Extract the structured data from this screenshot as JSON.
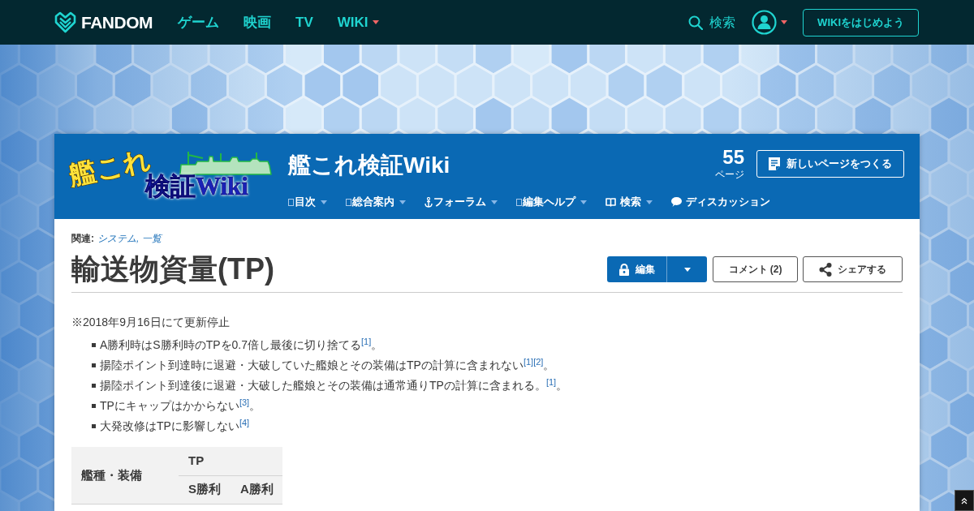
{
  "top_bar": {
    "brand": "FANDOM",
    "links": [
      {
        "label": "ゲーム",
        "has_menu": false
      },
      {
        "label": "映画",
        "has_menu": false
      },
      {
        "label": "TV",
        "has_menu": false
      },
      {
        "label": "WIKI",
        "has_menu": true
      }
    ],
    "search": {
      "label": "検索"
    },
    "start_wiki_button": "WIKIをはじめよう"
  },
  "wiki_header": {
    "logo": {
      "line_1": "艦これ",
      "line_2": "検証Wiki"
    },
    "title": "艦これ検証Wiki",
    "page_count": "55",
    "page_count_label": "ページ",
    "new_page_button": "新しいページをつくる",
    "nav": [
      {
        "label": "目次",
        "kind": "plain",
        "has_menu": true
      },
      {
        "label": "総合案内",
        "kind": "plain",
        "has_menu": true
      },
      {
        "label": "フォーラム",
        "kind": "anchor",
        "has_menu": true
      },
      {
        "label": "編集ヘルプ",
        "kind": "plain",
        "has_menu": true
      },
      {
        "label": "検索",
        "kind": "book",
        "has_menu": true
      },
      {
        "label": "ディスカッション",
        "kind": "chat",
        "has_menu": false
      }
    ]
  },
  "article": {
    "categories_label": "関連:",
    "categories": [
      "システム,",
      "一覧"
    ],
    "title": "輸送物資量(TP)",
    "actions": {
      "edit": "編集",
      "comments": "コメント (2)",
      "share": "シェアする"
    },
    "note": "※2018年9月16日にて更新停止",
    "bullets": [
      {
        "text": "A勝利時はS勝利時のTPを0.7倍し最後に切り捨てる",
        "refs": [
          "[1]"
        ],
        "tail": "。"
      },
      {
        "text": "揚陸ポイント到達時に退避・大破していた艦娘とその装備はTPの計算に含まれない",
        "refs": [
          "[1]",
          "[2]"
        ],
        "tail": "。"
      },
      {
        "text": "揚陸ポイント到達後に退避・大破した艦娘とその装備は通常通りTPの計算に含まれる。",
        "refs": [
          "[1]"
        ],
        "tail": "。"
      },
      {
        "text": "TPにキャップはかからない",
        "refs": [
          "[3]"
        ],
        "tail": "。"
      },
      {
        "text": "大発改修はTPに影響しない",
        "refs": [
          "[4]"
        ]
      }
    ],
    "table": {
      "row_header": "艦種・装備",
      "group": "TP",
      "columns": [
        "S勝利",
        "A勝利"
      ]
    }
  }
}
